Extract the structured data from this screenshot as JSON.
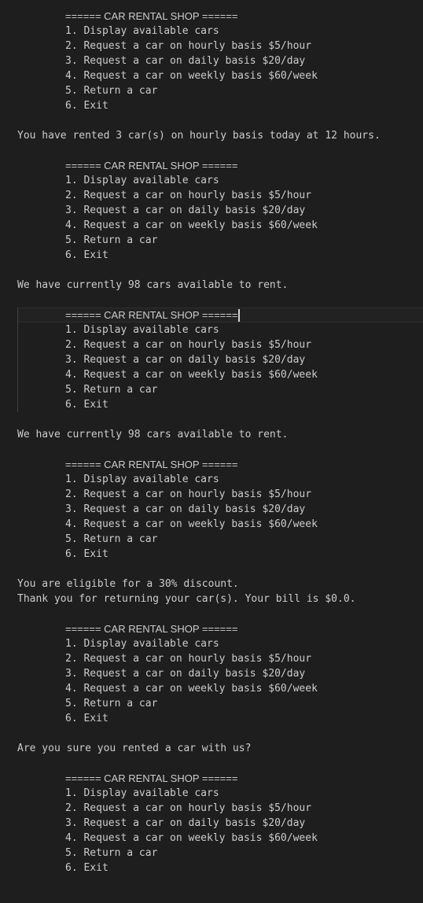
{
  "menu": {
    "header": "====== CAR RENTAL SHOP ======",
    "items": [
      "1. Display available cars",
      "2. Request a car on hourly basis $5/hour",
      "3. Request a car on daily basis $20/day",
      "4. Request a car on weekly basis $60/week",
      "5. Return a car",
      "6. Exit"
    ]
  },
  "messages": [
    [
      "You have rented 3 car(s) on hourly basis today at 12 hours."
    ],
    [
      "We have currently 98 cars available to rent."
    ],
    [
      "We have currently 98 cars available to rent."
    ],
    [
      "You are eligible for a 30% discount.",
      "Thank you for returning your car(s). Your bill is $0.0."
    ],
    [
      "Are you sure you rented a car with us?"
    ]
  ]
}
